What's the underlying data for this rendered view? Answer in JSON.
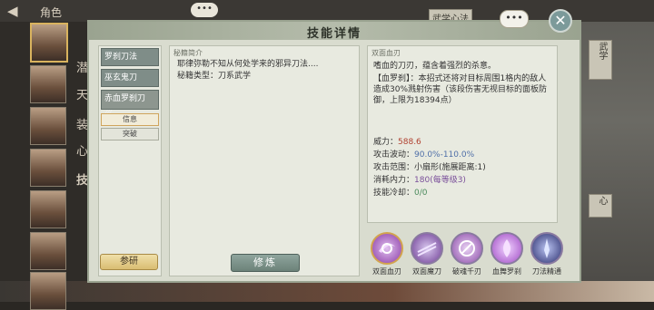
{
  "background": {
    "back_glyph": "◀",
    "role_title": "角色",
    "side_chars": [
      "潜",
      "天",
      "装",
      "心",
      "技"
    ],
    "chips": [
      "武学心法",
      "武学",
      "心"
    ],
    "dots": "•••"
  },
  "dialog": {
    "title": "技能详情",
    "chat": "•••",
    "close": "✕"
  },
  "skills": [
    {
      "label": "罗刹刀法"
    },
    {
      "label": "巫玄鬼刀"
    },
    {
      "label": "赤血罗刹刀",
      "slashes": "⁄⁄⁄"
    }
  ],
  "subtabs": [
    "信息",
    "突破"
  ],
  "study_label": "参研",
  "practice_label": "修炼",
  "middle": {
    "header": "秘籍简介",
    "desc": "耶律弥勒不知从何处学来的邪异刀法....",
    "type_line": "秘籍类型：刀系武学"
  },
  "right": {
    "header": "双面血刃",
    "line1": "嗜血的刀刃，蕴含着强烈的杀意。",
    "effect": "【血罗刹】：本招式还将对目标周围1格内的敌人造成30%溅射伤害（该段伤害无视目标的面板防御，上限为18394点）",
    "stats": [
      {
        "label": "威力：",
        "value": "588.6",
        "color": "#b0402f"
      },
      {
        "label": "攻击波动：",
        "value": "90.0%-110.0%",
        "color": "#4f6fa8"
      },
      {
        "label": "攻击范围：",
        "value": "小扇形(施展距离:1)",
        "color": "#333333"
      },
      {
        "label": "消耗内力：",
        "value": "180(每等级3)",
        "color": "#7a4f9a"
      },
      {
        "label": "技能冷却：",
        "value": "0/0",
        "color": "#4a8a5c"
      }
    ]
  },
  "skill_icons": [
    {
      "label": "双面血刃",
      "icon": "blood-blade-icon"
    },
    {
      "label": "双面魔刀",
      "icon": "demon-blade-icon"
    },
    {
      "label": "破魂千刃",
      "icon": "soul-break-icon"
    },
    {
      "label": "血舞罗刹",
      "icon": "blood-dance-icon"
    },
    {
      "label": "刀法精通",
      "icon": "blade-mastery-icon"
    }
  ]
}
